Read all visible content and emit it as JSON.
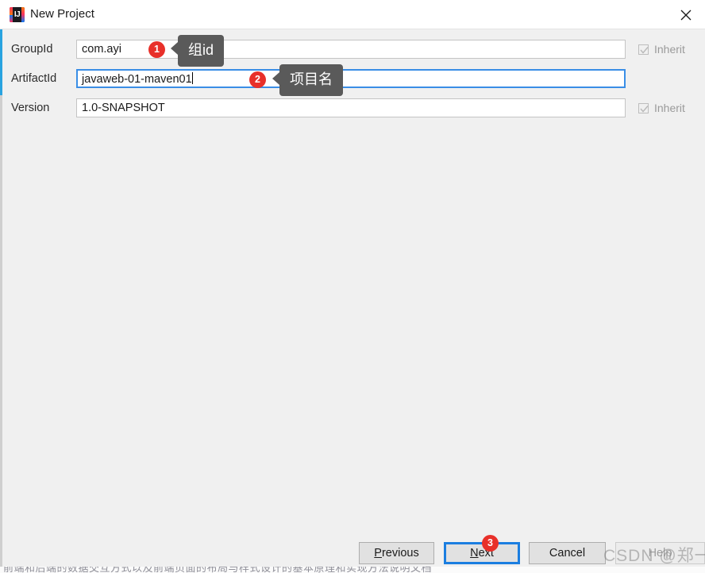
{
  "window": {
    "title": "New Project",
    "app_icon": "intellij-idea-icon",
    "close_icon": "close-icon"
  },
  "form": {
    "rows": [
      {
        "label": "GroupId",
        "value": "com.ayi",
        "focused": false,
        "inherit_label": "Inherit",
        "inherit_checked": true,
        "inherit_disabled": true
      },
      {
        "label": "ArtifactId",
        "value": "javaweb-01-maven01",
        "focused": true,
        "inherit_label": "",
        "inherit_checked": false,
        "inherit_disabled": false
      },
      {
        "label": "Version",
        "value": "1.0-SNAPSHOT",
        "focused": false,
        "inherit_label": "Inherit",
        "inherit_checked": true,
        "inherit_disabled": true
      }
    ]
  },
  "annotations": [
    {
      "number": "1",
      "tooltip": "组id"
    },
    {
      "number": "2",
      "tooltip": "项目名"
    },
    {
      "number": "3",
      "tooltip": ""
    }
  ],
  "buttons": {
    "previous": {
      "label": "Previous",
      "mnemonic": "P",
      "rest": "revious"
    },
    "next": {
      "label": "Next",
      "mnemonic": "N",
      "rest": "ext",
      "focused": true
    },
    "cancel": {
      "label": "Cancel"
    },
    "help": {
      "label": "Help",
      "disabled": true
    }
  },
  "watermark": {
    "text": "CSDN @郑一笔"
  },
  "footer_sliver": {
    "text": "前端和后端的数据交互方式以及前端页面的布局与样式设计的基本原理和实现方法说明文档"
  },
  "colors": {
    "badge_red": "#e8302a",
    "tooltip_gray": "#5a5a5a",
    "focus_blue": "#3a8ee6",
    "dialog_bg": "#f0f0f0"
  }
}
